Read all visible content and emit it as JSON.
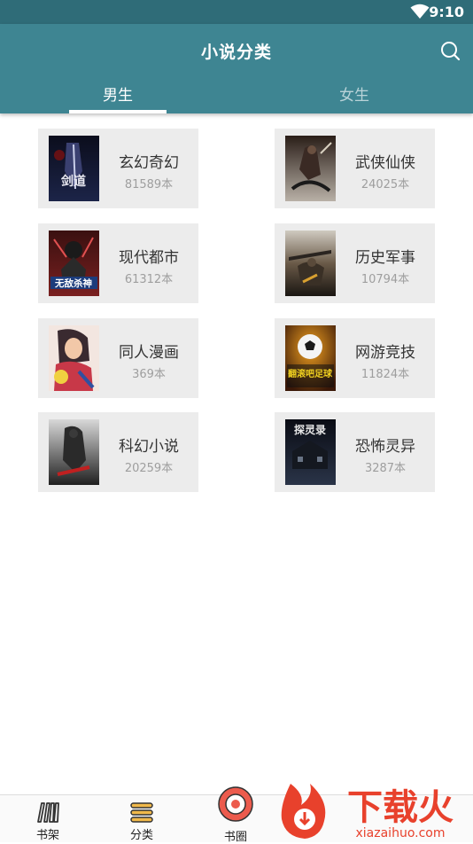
{
  "status_bar": {
    "time": "9:10",
    "icons": [
      "wifi-icon"
    ]
  },
  "header": {
    "title": "小说分类",
    "search_icon": "search-icon"
  },
  "tabs": [
    {
      "label": "男生",
      "active": true
    },
    {
      "label": "女生",
      "active": false
    }
  ],
  "categories": [
    {
      "name": "玄幻奇幻",
      "count": "81589本",
      "cover_text": "剑道"
    },
    {
      "name": "武侠仙侠",
      "count": "24025本",
      "cover_text": ""
    },
    {
      "name": "现代都市",
      "count": "61312本",
      "cover_text": "无敌杀神"
    },
    {
      "name": "历史军事",
      "count": "10794本",
      "cover_text": ""
    },
    {
      "name": "同人漫画",
      "count": "369本",
      "cover_text": ""
    },
    {
      "name": "网游竞技",
      "count": "11824本",
      "cover_text": "翻滚吧足球"
    },
    {
      "name": "科幻小说",
      "count": "20259本",
      "cover_text": ""
    },
    {
      "name": "恐怖灵异",
      "count": "3287本",
      "cover_text": "探灵录"
    }
  ],
  "bottom_nav": [
    {
      "label": "书架",
      "icon": "bookshelf-icon"
    },
    {
      "label": "分类",
      "icon": "category-icon"
    },
    {
      "label": "书圈",
      "icon": "book-circle-icon"
    }
  ],
  "watermark": {
    "text": "下载火",
    "url_text": "xiazaihuo.com"
  },
  "colors": {
    "header": "#3e8592",
    "status_bar": "#2f6c78",
    "card_bg": "#ececec",
    "accent_red": "#e8412c"
  }
}
